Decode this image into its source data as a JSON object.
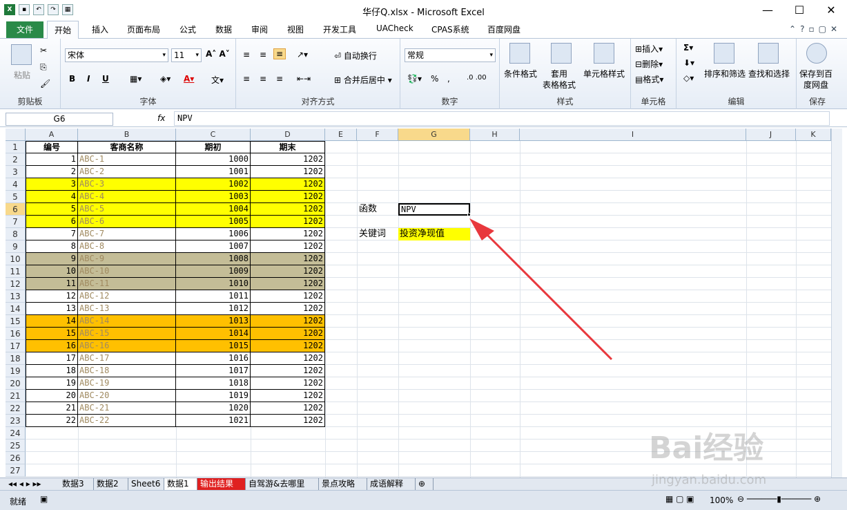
{
  "window": {
    "title": "华仔Q.xlsx  -  Microsoft Excel",
    "minimize": "—",
    "maximize": "☐",
    "close": "✕"
  },
  "tabs": {
    "file": "文件",
    "items": [
      "开始",
      "插入",
      "页面布局",
      "公式",
      "数据",
      "审阅",
      "视图",
      "开发工具",
      "UACheck",
      "CPAS系统",
      "百度网盘"
    ]
  },
  "ribbon": {
    "clipboard": {
      "paste": "粘贴",
      "label": "剪贴板"
    },
    "font": {
      "name": "宋体",
      "size": "11",
      "label": "字体",
      "bold": "B",
      "italic": "I",
      "underline": "U"
    },
    "align": {
      "wrap": "自动换行",
      "merge": "合并后居中",
      "label": "对齐方式"
    },
    "number": {
      "format": "常规",
      "label": "数字",
      "percent": "%"
    },
    "styles": {
      "cond": "条件格式",
      "table1": "套用",
      "table2": "表格格式",
      "cell": "单元格样式",
      "label": "样式"
    },
    "cells": {
      "insert": "插入",
      "delete": "删除",
      "format": "格式",
      "label": "单元格"
    },
    "editing": {
      "sort": "排序和筛选",
      "find": "查找和选择",
      "label": "编辑"
    },
    "save": {
      "line1": "保存到百",
      "line2": "度网盘",
      "label": "保存"
    }
  },
  "formula": {
    "namebox": "G6",
    "fx": "fx",
    "value": "NPV"
  },
  "columns": [
    "A",
    "B",
    "C",
    "D",
    "E",
    "F",
    "G",
    "H",
    "I",
    "J",
    "K"
  ],
  "headers": [
    "编号",
    "客商名称",
    "期初",
    "期末"
  ],
  "rows": [
    {
      "a": "1",
      "b": "ABC-1",
      "c": "1000",
      "d": "1202",
      "fill": "#ffffff"
    },
    {
      "a": "2",
      "b": "ABC-2",
      "c": "1001",
      "d": "1202",
      "fill": "#ffffff"
    },
    {
      "a": "3",
      "b": "ABC-3",
      "c": "1002",
      "d": "1202",
      "fill": "#ffff00"
    },
    {
      "a": "4",
      "b": "ABC-4",
      "c": "1003",
      "d": "1202",
      "fill": "#ffff00"
    },
    {
      "a": "5",
      "b": "ABC-5",
      "c": "1004",
      "d": "1202",
      "fill": "#ffff00"
    },
    {
      "a": "6",
      "b": "ABC-6",
      "c": "1005",
      "d": "1202",
      "fill": "#ffff00"
    },
    {
      "a": "7",
      "b": "ABC-7",
      "c": "1006",
      "d": "1202",
      "fill": "#ffffff"
    },
    {
      "a": "8",
      "b": "ABC-8",
      "c": "1007",
      "d": "1202",
      "fill": "#ffffff"
    },
    {
      "a": "9",
      "b": "ABC-9",
      "c": "1008",
      "d": "1202",
      "fill": "#c4bd97"
    },
    {
      "a": "10",
      "b": "ABC-10",
      "c": "1009",
      "d": "1202",
      "fill": "#c4bd97"
    },
    {
      "a": "11",
      "b": "ABC-11",
      "c": "1010",
      "d": "1202",
      "fill": "#c4bd97"
    },
    {
      "a": "12",
      "b": "ABC-12",
      "c": "1011",
      "d": "1202",
      "fill": "#ffffff"
    },
    {
      "a": "13",
      "b": "ABC-13",
      "c": "1012",
      "d": "1202",
      "fill": "#ffffff"
    },
    {
      "a": "14",
      "b": "ABC-14",
      "c": "1013",
      "d": "1202",
      "fill": "#ffc000"
    },
    {
      "a": "15",
      "b": "ABC-15",
      "c": "1014",
      "d": "1202",
      "fill": "#ffc000"
    },
    {
      "a": "16",
      "b": "ABC-16",
      "c": "1015",
      "d": "1202",
      "fill": "#ffc000"
    },
    {
      "a": "17",
      "b": "ABC-17",
      "c": "1016",
      "d": "1202",
      "fill": "#ffffff"
    },
    {
      "a": "18",
      "b": "ABC-18",
      "c": "1017",
      "d": "1202",
      "fill": "#ffffff"
    },
    {
      "a": "19",
      "b": "ABC-19",
      "c": "1018",
      "d": "1202",
      "fill": "#ffffff"
    },
    {
      "a": "20",
      "b": "ABC-20",
      "c": "1019",
      "d": "1202",
      "fill": "#ffffff"
    },
    {
      "a": "21",
      "b": "ABC-21",
      "c": "1020",
      "d": "1202",
      "fill": "#ffffff"
    },
    {
      "a": "22",
      "b": "ABC-22",
      "c": "1021",
      "d": "1202",
      "fill": "#ffffff"
    }
  ],
  "side": {
    "f6": "函数",
    "g6": "NPV",
    "f8": "关键词",
    "g8": "投资净现值"
  },
  "sheets": [
    "数据3",
    "数据2",
    "Sheet6",
    "数据1",
    "输出结果",
    "自驾游&去哪里",
    "景点攻略",
    "成语解释"
  ],
  "status": {
    "ready": "就绪",
    "zoom": "100%"
  },
  "watermark": {
    "brand": "Bai经验",
    "url": "jingyan.baidu.com"
  }
}
